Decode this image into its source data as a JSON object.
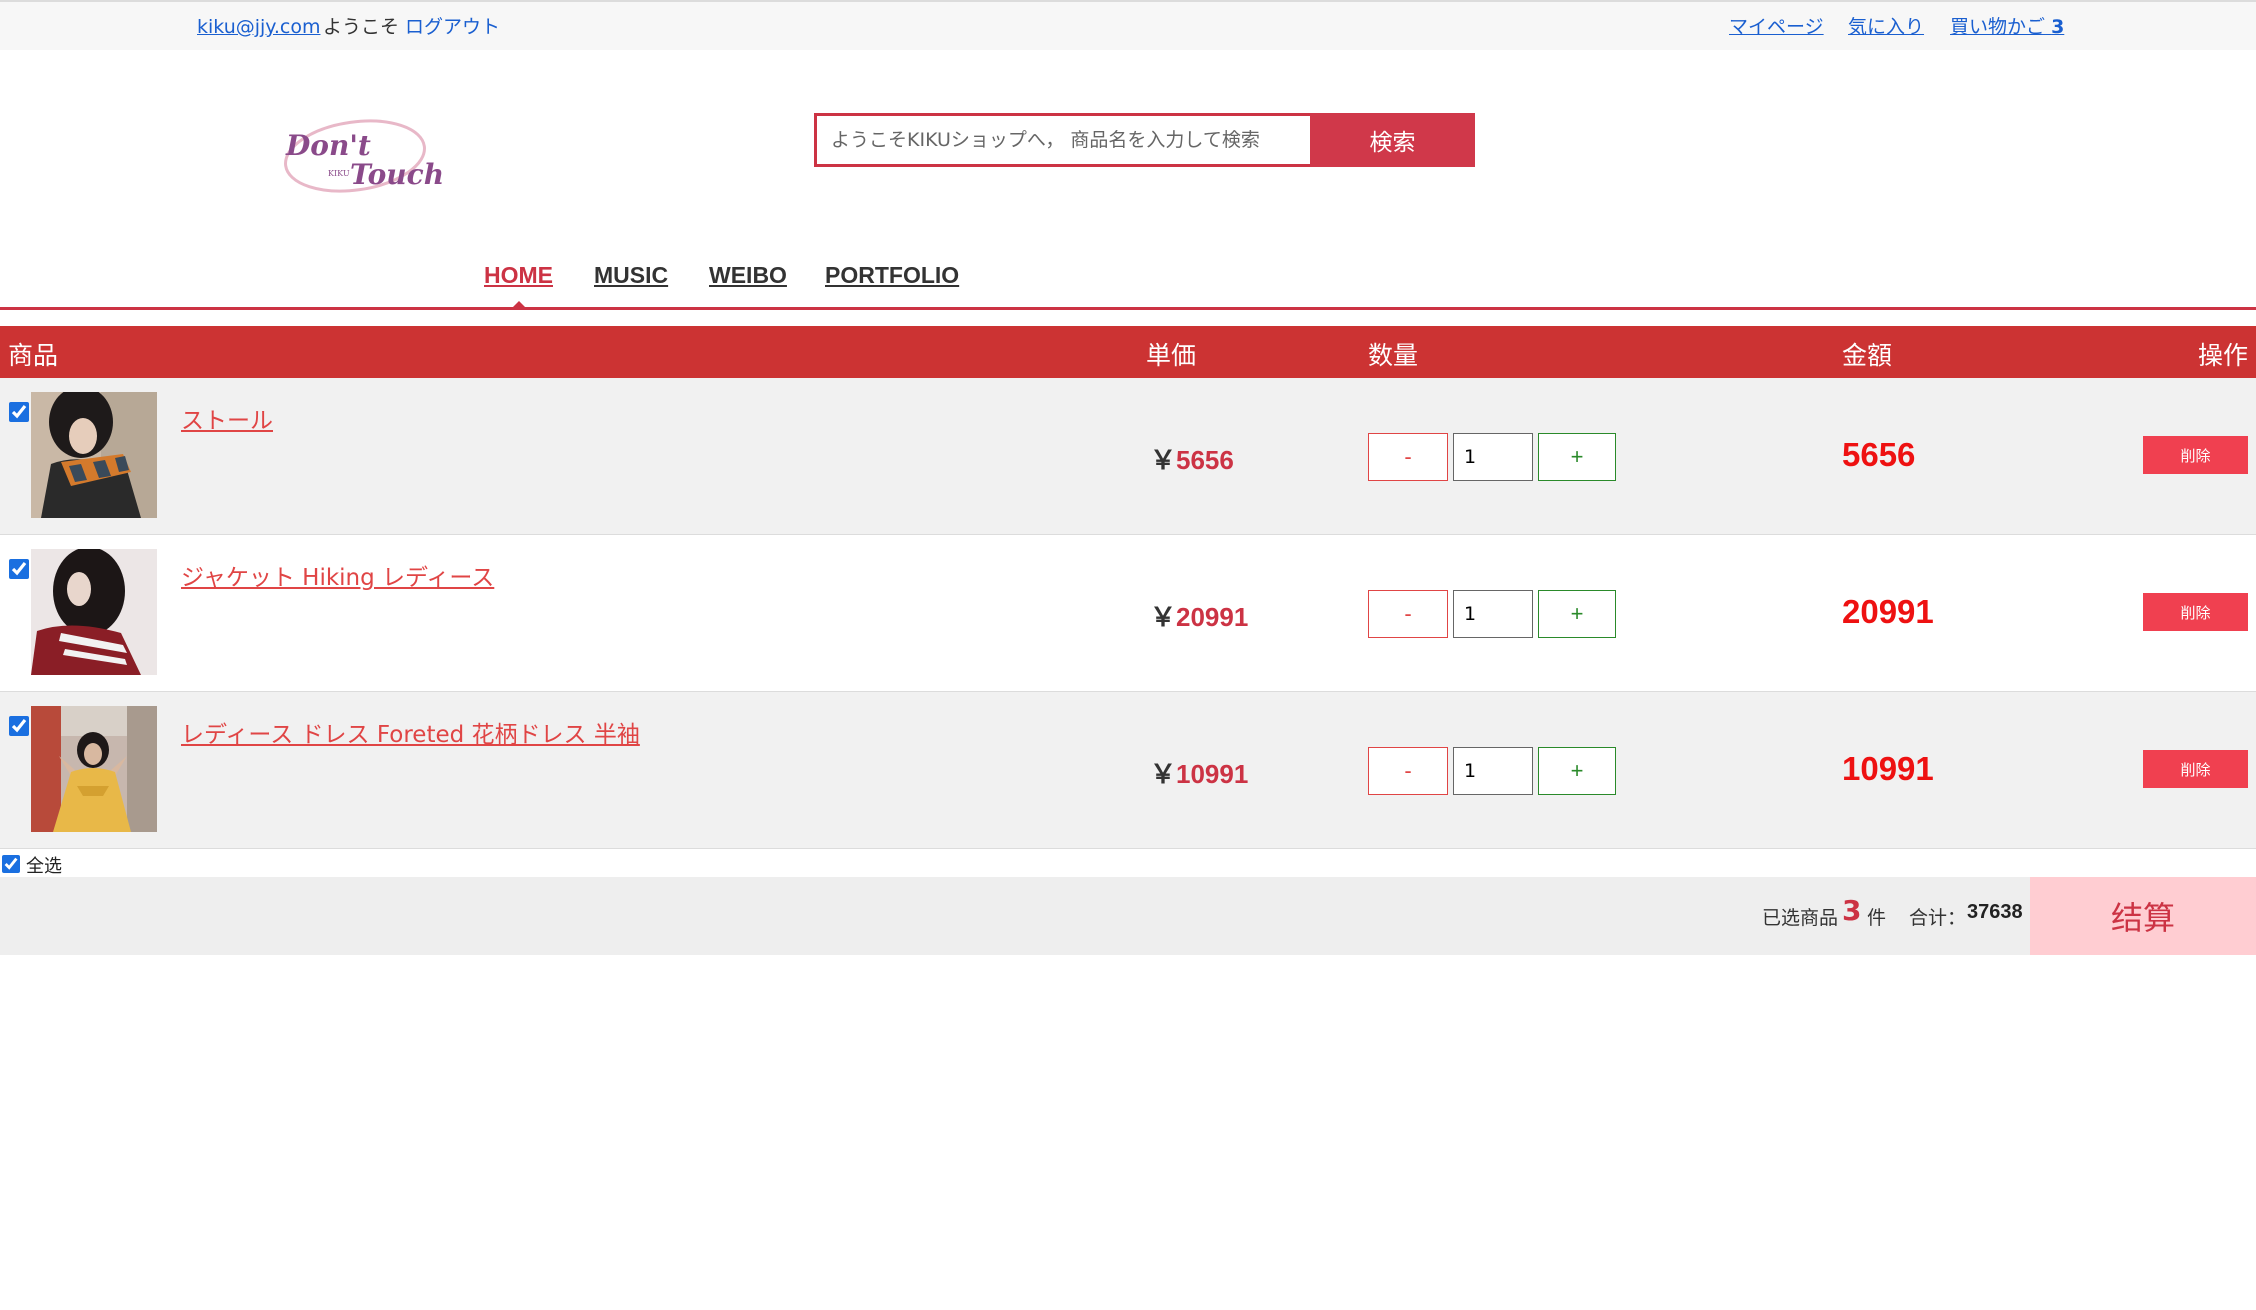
{
  "topbar": {
    "email": "kiku@jjy.com",
    "welcome": "ようこそ",
    "logout": "ログアウト",
    "mypage": "マイページ",
    "favorites": "気に入り",
    "cart_label": "買い物かご",
    "cart_count": "3"
  },
  "logo": {
    "line1": "Don't",
    "line2": "Touch",
    "small": "KIKU"
  },
  "search": {
    "placeholder": "ようこそKIKUショップへ， 商品名を入力して検索",
    "button": "検索"
  },
  "nav": {
    "items": [
      "HOME",
      "MUSIC",
      "WEIBO",
      "PORTFOLIO"
    ],
    "active": "HOME"
  },
  "table": {
    "headers": {
      "product": "商品",
      "unit_price": "単価",
      "quantity": "数量",
      "amount": "金額",
      "action": "操作"
    },
    "currency": "￥",
    "minus": "-",
    "plus": "+",
    "delete": "削除",
    "rows": [
      {
        "name": "ストール",
        "price": "5656",
        "qty": "1",
        "amount": "5656",
        "checked": true
      },
      {
        "name": "ジャケット Hiking レディース",
        "price": "20991",
        "qty": "1",
        "amount": "20991",
        "checked": true
      },
      {
        "name": "レディース ドレス Foreted 花柄ドレス 半袖",
        "price": "10991",
        "qty": "1",
        "amount": "10991",
        "checked": true
      }
    ]
  },
  "footer": {
    "select_all": "全选",
    "selected_label": "已选商品",
    "selected_count": "3",
    "unit": "件",
    "total_label": "合计：",
    "total": "37638",
    "checkout": "结算"
  },
  "colors": {
    "accent": "#cc3344",
    "header_bg": "#cc3333",
    "link": "#1a5fd0",
    "amount": "#ee1111",
    "checkout_bg": "#ffcdd2"
  }
}
